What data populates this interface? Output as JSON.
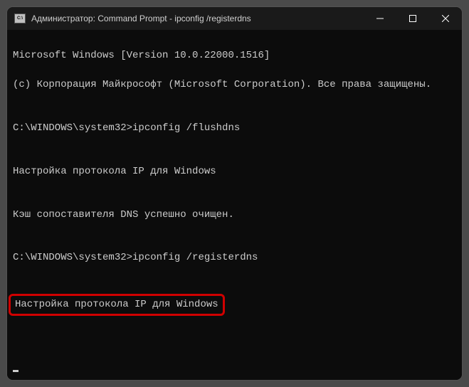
{
  "window": {
    "title": "Администратор: Command Prompt - ipconfig  /registerdns",
    "icon_label": "C:\\"
  },
  "terminal": {
    "lines": [
      "Microsoft Windows [Version 10.0.22000.1516]",
      "(c) Корпорация Майкрософт (Microsoft Corporation). Все права защищены.",
      "",
      "C:\\WINDOWS\\system32>ipconfig /flushdns",
      "",
      "Настройка протокола IP для Windows",
      "",
      "Кэш сопоставителя DNS успешно очищен.",
      "",
      "C:\\WINDOWS\\system32>ipconfig /registerdns",
      ""
    ],
    "highlighted_line": "Настройка протокола IP для Windows"
  }
}
